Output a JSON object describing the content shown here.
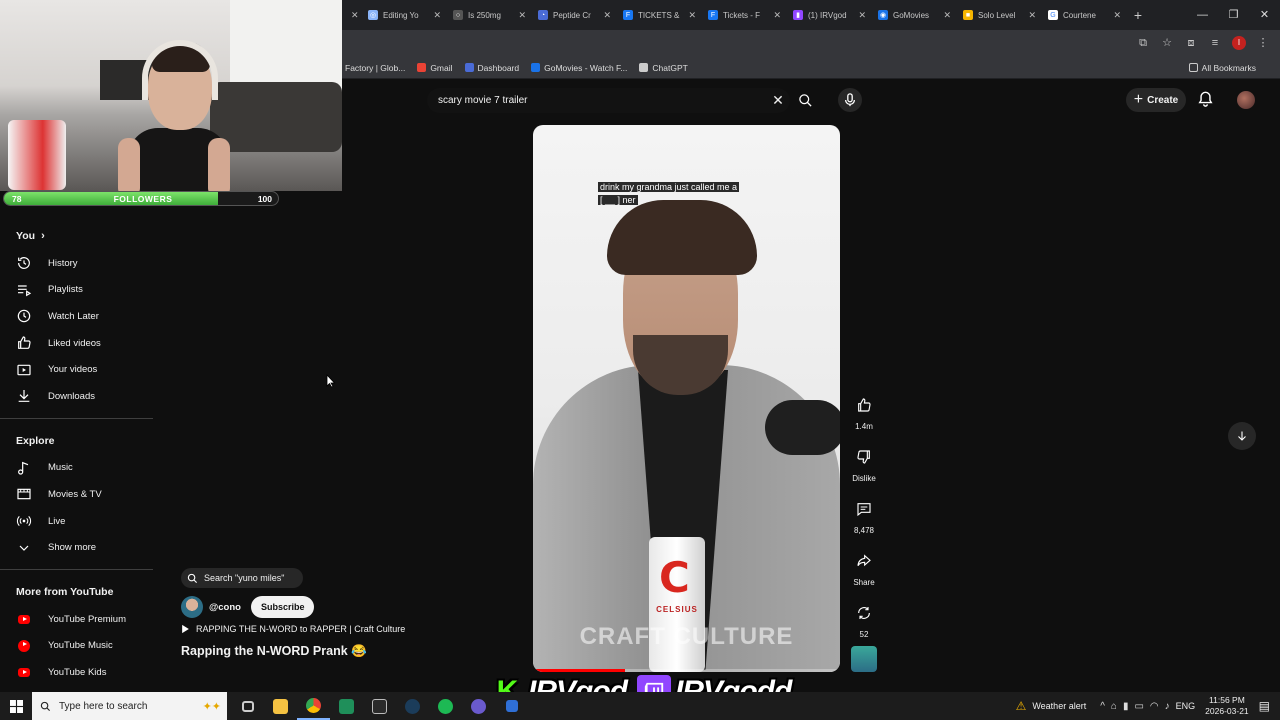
{
  "browser": {
    "tabs": [
      {
        "title": "Editing Yo",
        "color": "#8ab4f8",
        "glyph": "◎"
      },
      {
        "title": "Is 250mg",
        "color": "#555555",
        "glyph": "○"
      },
      {
        "title": "Peptide Cr",
        "color": "#4a6bd6",
        "glyph": "◔"
      },
      {
        "title": "TICKETS &",
        "color": "#1877f2",
        "glyph": "F"
      },
      {
        "title": "Tickets - F",
        "color": "#1877f2",
        "glyph": "F"
      },
      {
        "title": "(1) IRVgod",
        "color": "#9146ff",
        "glyph": "▮"
      },
      {
        "title": "GoMovies",
        "color": "#1a73e8",
        "glyph": "◉"
      },
      {
        "title": "Solo Level",
        "color": "#f4b400",
        "glyph": "■"
      },
      {
        "title": "Courtene",
        "color": "#ffffff",
        "glyph": "G"
      }
    ],
    "bookmarks": [
      {
        "label": "Factory | Glob...",
        "color": ""
      },
      {
        "label": "Gmail",
        "color": "#ea4335"
      },
      {
        "label": "Dashboard",
        "color": "#4a6bd6"
      },
      {
        "label": "GoMovies - Watch F...",
        "color": "#1a73e8"
      },
      {
        "label": "ChatGPT",
        "color": "#cccccc"
      }
    ],
    "all_bookmarks": "All Bookmarks"
  },
  "webcam": {
    "followers_label": "FOLLOWERS",
    "current": "78",
    "goal": "100",
    "progress": 0.78
  },
  "youtube": {
    "search_value": "scary movie 7 trailer",
    "create_label": "Create",
    "sidebar": {
      "you_label": "You",
      "you_items": [
        "History",
        "Playlists",
        "Watch Later",
        "Liked videos",
        "Your videos",
        "Downloads"
      ],
      "explore_label": "Explore",
      "explore_items": [
        "Music",
        "Movies & TV",
        "Live",
        "Show more"
      ],
      "more_label": "More from YouTube",
      "more_items": [
        "YouTube Premium",
        "YouTube Music",
        "YouTube Kids"
      ]
    },
    "short": {
      "caption_line1": "drink my grandma just called me a",
      "caption_line2": "[ __ ] ner",
      "can_brand": "CELSIUS",
      "watermark": "CRAFT CULTURE",
      "likes": "1.4m",
      "dislike_label": "Dislike",
      "comments": "8,478",
      "share_label": "Share",
      "remixes": "52"
    },
    "suggest_search": "Search \"yuno miles\"",
    "channel_handle": "@cono",
    "subscribe_label": "Subscribe",
    "playlist_line": "RAPPING THE N-WORD to RAPPER | Craft Culture",
    "video_title": "Rapping the N-WORD Prank 😂"
  },
  "overlay": {
    "kick_name": "IRVgod",
    "twitch_name": "IRVgodd"
  },
  "taskbar": {
    "search_placeholder": "Type here to search",
    "weather": "Weather alert",
    "lang": "ENG",
    "time": "11:56 PM",
    "date": "2026-03-21"
  }
}
